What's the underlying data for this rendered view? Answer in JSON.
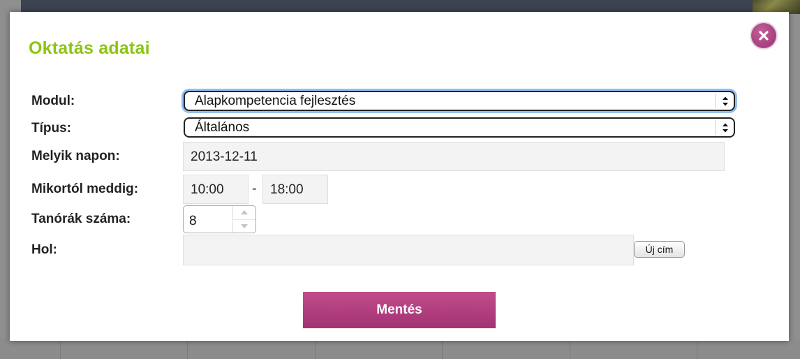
{
  "modal": {
    "title": "Oktatás adatai",
    "close_icon": "close-icon",
    "save_label": "Mentés"
  },
  "form": {
    "modul": {
      "label": "Modul:",
      "value": "Alapkompetencia fejlesztés"
    },
    "tipus": {
      "label": "Típus:",
      "value": "Általános"
    },
    "melyik_napon": {
      "label": "Melyik napon:",
      "value": "2013-12-11"
    },
    "mikortol": {
      "label": "Mikortól meddig:",
      "from": "10:00",
      "separator": "-",
      "to": "18:00"
    },
    "tanorak": {
      "label": "Tanórák száma:",
      "value": "8"
    },
    "hol": {
      "label": "Hol:",
      "value": "",
      "new_address_label": "Új cím"
    }
  },
  "colors": {
    "title": "#8cc413",
    "accent": "#b0417f",
    "focus_ring": "#8fbfef"
  }
}
